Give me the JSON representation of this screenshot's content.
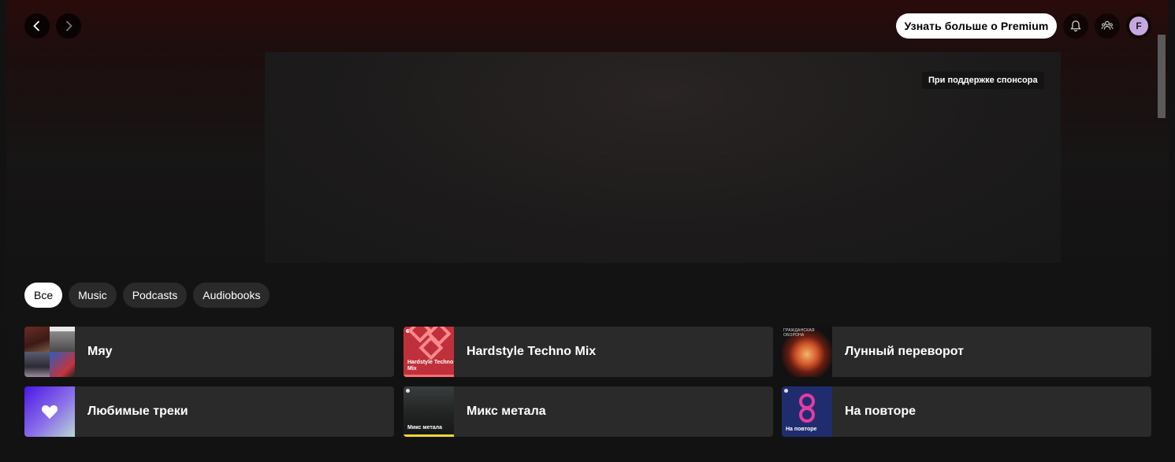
{
  "topbar": {
    "premium_label": "Узнать больше о Premium",
    "avatar_initial": "F"
  },
  "ad": {
    "sponsor_label": "При поддержке спонсора"
  },
  "filters": [
    "Все",
    "Music",
    "Podcasts",
    "Audiobooks"
  ],
  "shortcuts": [
    {
      "title": "Мяу"
    },
    {
      "title": "Hardstyle Techno Mix",
      "cover_text": "Hardstyle Techno Mix"
    },
    {
      "title": "Лунный переворот",
      "cover_text": "ГРАЖДАНСКАЯ ОБОРОНА"
    },
    {
      "title": "Любимые треки"
    },
    {
      "title": "Микс метала",
      "cover_text": "Микс метала"
    },
    {
      "title": "На повторе",
      "cover_text": "На повторе"
    }
  ],
  "colors": {
    "background": "#121212",
    "card": "#2a2a2a",
    "header_tint": "#2a0b0b",
    "chip_active": "#ffffff"
  }
}
